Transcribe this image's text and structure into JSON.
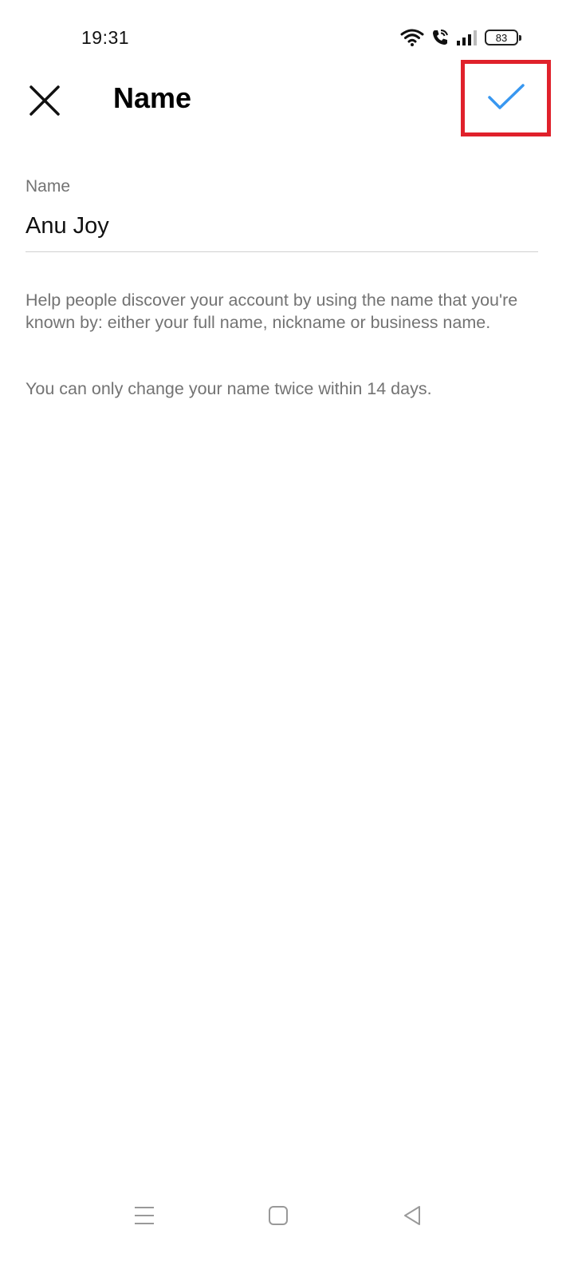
{
  "status_bar": {
    "time": "19:31",
    "battery_level": "83",
    "icons": [
      "wifi-icon",
      "wifi-call-icon",
      "signal-icon",
      "battery-icon"
    ]
  },
  "header": {
    "title": "Name",
    "close_icon": "close-icon",
    "done_icon": "checkmark-icon",
    "accent_color": "#3897f0",
    "highlight_color": "#e0212b"
  },
  "form": {
    "label": "Name",
    "value": "Anu Joy"
  },
  "help_text": "Help people discover your account by using the name that you're known by: either your full name, nickname or business name.",
  "limit_text": "You can only change your name twice within 14 days.",
  "nav_bar": {
    "icons": [
      "menu-icon",
      "home-icon",
      "back-icon"
    ]
  }
}
